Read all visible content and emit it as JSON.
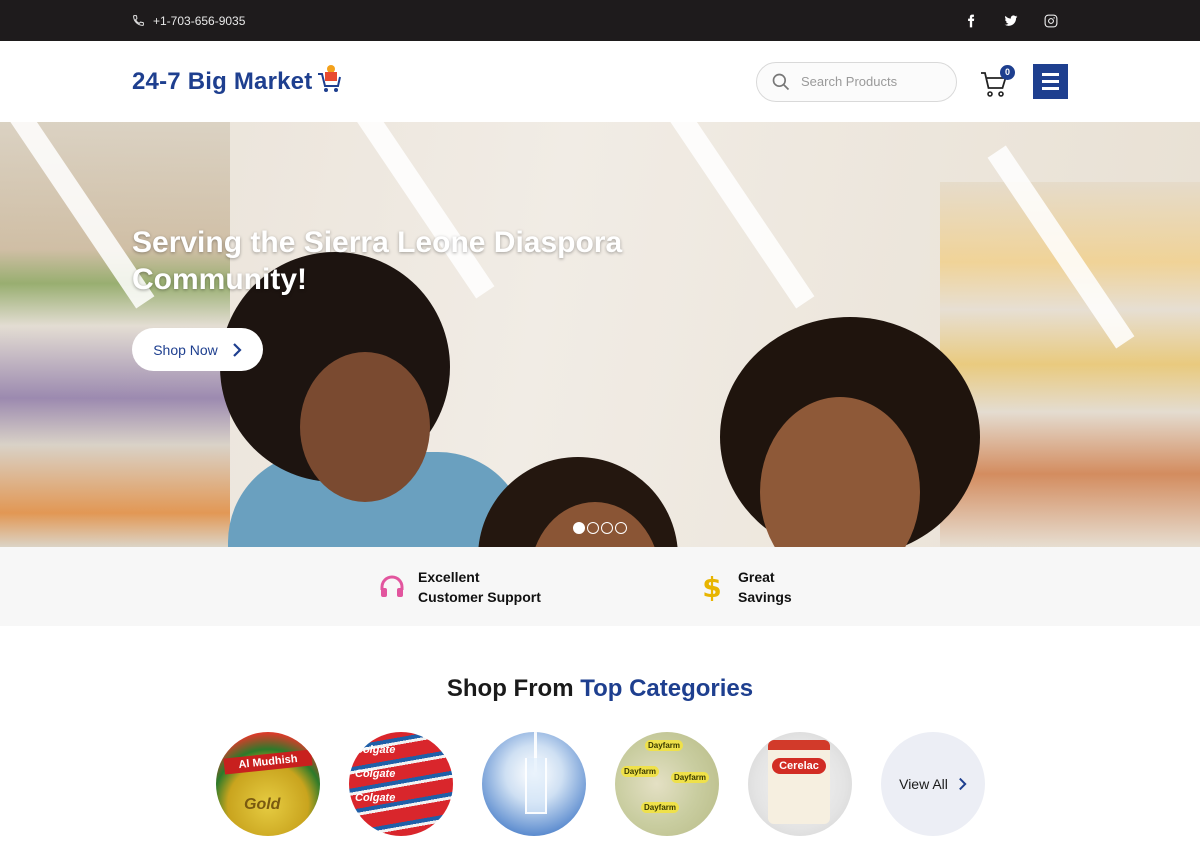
{
  "topbar": {
    "phone": "+1-703-656-9035",
    "social": [
      "facebook-icon",
      "twitter-icon",
      "instagram-icon"
    ]
  },
  "header": {
    "logo_text": "24-7 Big Market",
    "search_placeholder": "Search Products",
    "cart_count": "0"
  },
  "hero": {
    "title": "Serving the Sierra Leone Diaspora Community!",
    "button_label": "Shop Now",
    "slides": 4,
    "active_slide": 1
  },
  "features": [
    {
      "icon": "headphones-icon",
      "label": "Excellent Customer Support",
      "color": "#e2559e"
    },
    {
      "icon": "dollar-icon",
      "label": "Great Savings",
      "color": "#e8b500"
    }
  ],
  "categories": {
    "title_prefix": "Shop From",
    "title_highlight": "Top Categories",
    "items": [
      "Al Mudhish",
      "Colgate",
      "Water",
      "Dayfarm",
      "Cerelac"
    ],
    "view_all": "View All"
  },
  "colors": {
    "brand": "#1e3f8f",
    "topbar": "#1e1b1c"
  }
}
